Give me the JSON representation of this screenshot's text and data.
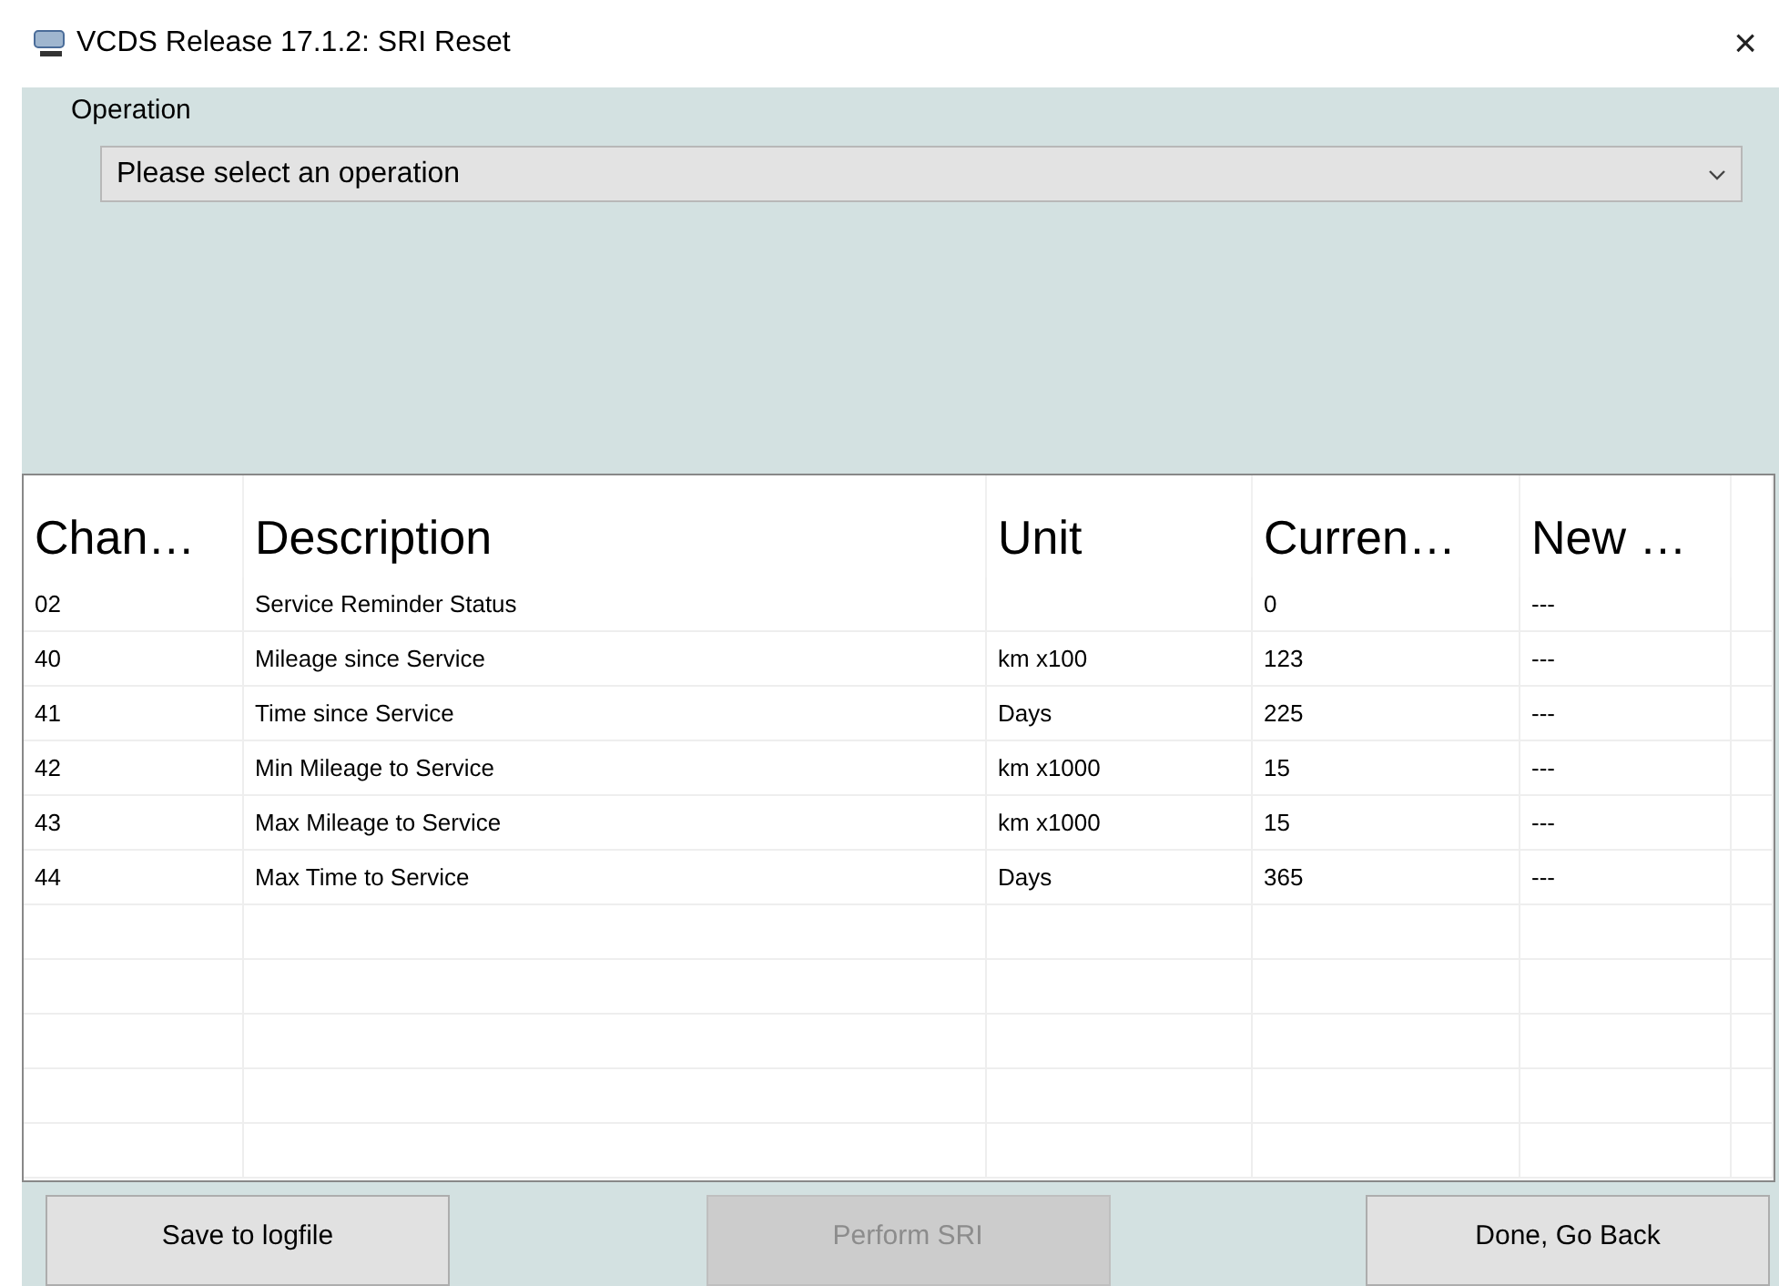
{
  "window": {
    "title": "VCDS Release 17.1.2:  SRI Reset",
    "close": "×"
  },
  "operation": {
    "label": "Operation",
    "placeholder": "Please select an operation"
  },
  "table": {
    "columns": [
      "Chan…",
      "Description",
      "Unit",
      "Curren…",
      "New …"
    ],
    "rows": [
      {
        "channel": "02",
        "description": "Service Reminder Status",
        "unit": "",
        "current": "0",
        "new": "---"
      },
      {
        "channel": "40",
        "description": "Mileage since Service",
        "unit": "km x100",
        "current": "123",
        "new": "---"
      },
      {
        "channel": "41",
        "description": "Time since Service",
        "unit": "Days",
        "current": "225",
        "new": "---"
      },
      {
        "channel": "42",
        "description": "Min Mileage to Service",
        "unit": "km x1000",
        "current": "15",
        "new": "---"
      },
      {
        "channel": "43",
        "description": "Max Mileage to Service",
        "unit": "km x1000",
        "current": "15",
        "new": "---"
      },
      {
        "channel": "44",
        "description": "Max Time to Service",
        "unit": "Days",
        "current": "365",
        "new": "---"
      }
    ]
  },
  "buttons": [
    {
      "label": "Save to logfile",
      "disabled": false
    },
    {
      "label": "Perform SRI",
      "disabled": true
    },
    {
      "label": "Done, Go Back",
      "disabled": false
    }
  ]
}
